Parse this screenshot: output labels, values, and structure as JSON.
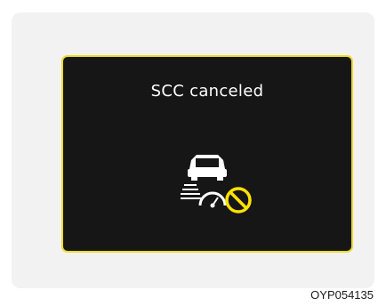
{
  "display": {
    "message": "SCC canceled",
    "icon": "scc-canceled-icon",
    "border_color": "#e9dc2b",
    "background_color": "#161616"
  },
  "caption": {
    "code": "OYP054135"
  }
}
